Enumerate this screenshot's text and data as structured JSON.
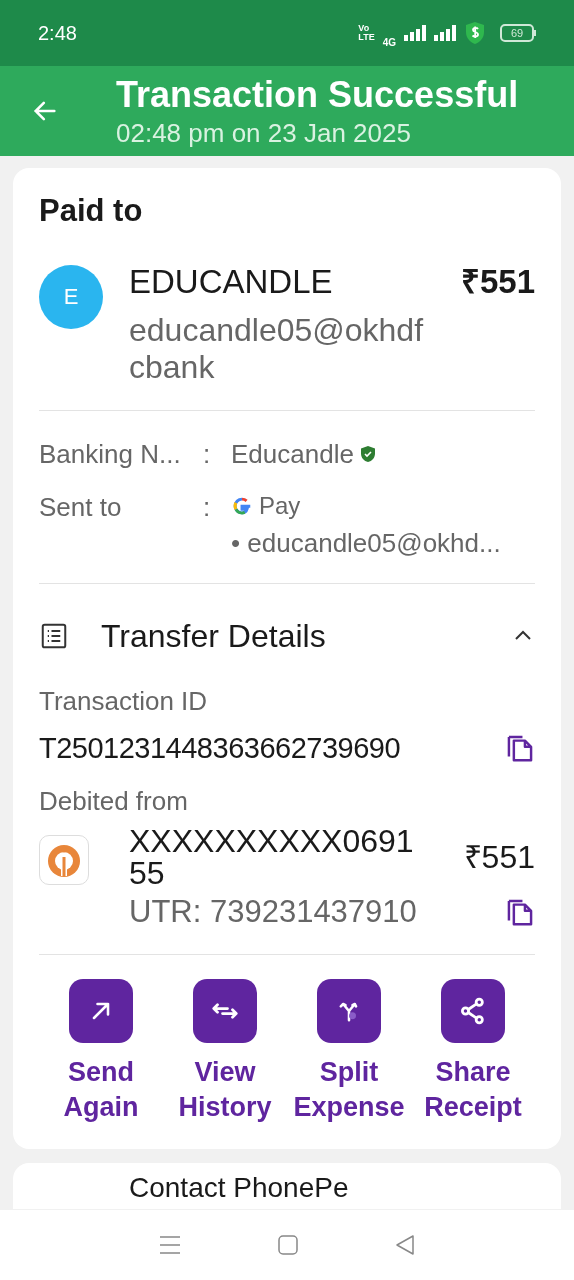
{
  "status_bar": {
    "time": "2:48",
    "volte_top": "Vo",
    "volte_bottom": "LTE",
    "network": "4G",
    "battery": "69"
  },
  "header": {
    "title": "Transaction Successful",
    "subtitle": "02:48 pm on 23 Jan 2025"
  },
  "paid_to": {
    "heading": "Paid to",
    "avatar_letter": "E",
    "name": "EDUCANDLE",
    "amount": "₹551",
    "upi_id": "educandle05@okhdfcbank"
  },
  "details": [
    {
      "label": "Banking N...",
      "separator": ":",
      "value": "Educandle",
      "kind": "verified"
    },
    {
      "label": "Sent to",
      "separator": ":",
      "value": "Pay",
      "sub_value": "• educandle05@okhd...",
      "kind": "gpay"
    }
  ],
  "transfer": {
    "title": "Transfer Details",
    "expanded": true,
    "transaction_label": "Transaction ID",
    "transaction_id": "T2501231448363662739690",
    "debited_label": "Debited from",
    "account": "XXXXXXXXXX069155",
    "amount": "₹551",
    "utr": "UTR: 739231437910"
  },
  "actions": [
    {
      "label": "Send Again",
      "kind": "send"
    },
    {
      "label": "View History",
      "kind": "history"
    },
    {
      "label": "Split Expense",
      "kind": "split"
    },
    {
      "label": "Share Receipt",
      "kind": "share"
    }
  ],
  "contact": {
    "title": "Contact PhonePe"
  }
}
